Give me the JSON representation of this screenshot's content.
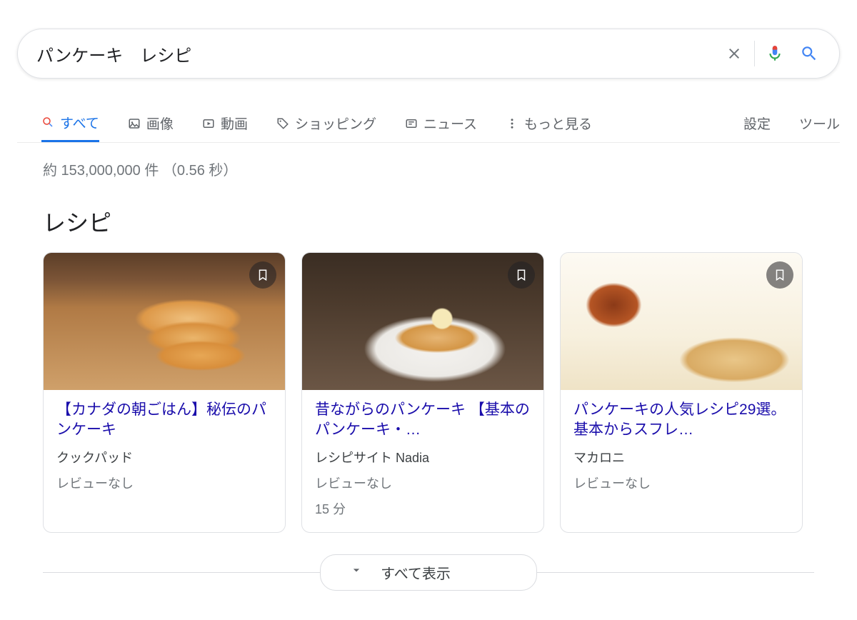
{
  "search": {
    "query": "パンケーキ　レシピ"
  },
  "tabs": {
    "all": "すべて",
    "images": "画像",
    "videos": "動画",
    "shopping": "ショッピング",
    "news": "ニュース",
    "more": "もっと見る",
    "settings": "設定",
    "tools": "ツール"
  },
  "stats": "約 153,000,000 件 （0.56 秒）",
  "section": {
    "title": "レシピ"
  },
  "cards": [
    {
      "title": "【カナダの朝ごはん】秘伝のパンケーキ",
      "source": "クックパッド",
      "review": "レビューなし",
      "time": ""
    },
    {
      "title": "昔ながらのパンケーキ 【基本のパンケーキ・…",
      "source": "レシピサイト Nadia",
      "review": "レビューなし",
      "time": "15 分"
    },
    {
      "title": "パンケーキの人気レシピ29選。基本からスフレ…",
      "source": "マカロニ",
      "review": "レビューなし",
      "time": ""
    }
  ],
  "showall": "すべて表示"
}
